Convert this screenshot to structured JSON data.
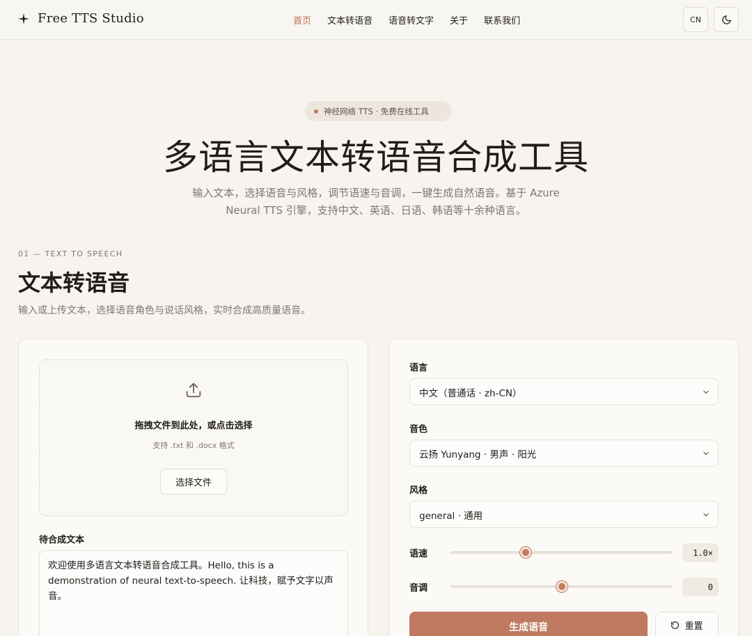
{
  "header": {
    "brand": "Free TTS Studio",
    "brand_icon": "sparkle-icon",
    "nav": [
      "首页",
      "文本转语音",
      "语音转文字",
      "关于",
      "联系我们"
    ],
    "active_nav": "首页",
    "lang_button": "CN",
    "theme_icon": "moon-icon"
  },
  "hero": {
    "badge": "神经网络 TTS · 免费在线工具",
    "title": "多语言文本转语音合成工具",
    "subtitle_line1": "输入文本，选择语音与风格，调节语速与音调，一键生成自然语音。基于 Azure",
    "subtitle_line2": "Neural TTS 引擎，支持中文、英语、日语、韩语等十余种语言。"
  },
  "section": {
    "eyebrow": "01 — TEXT TO SPEECH",
    "title": "文本转语音",
    "description": "输入或上传文本，选择语音角色与说话风格，实时合成高质量语音。"
  },
  "upload": {
    "icon": "upload-icon",
    "title": "拖拽文件到此处，或点击选择",
    "hint": "支持 .txt 和 .docx 格式",
    "button": "选择文件"
  },
  "text_input": {
    "label": "待合成文本",
    "value": "欢迎使用多语言文本转语音合成工具。Hello, this is a demonstration of neural text-to-speech. 让科技，赋予文字以声音。"
  },
  "settings": {
    "language_label": "语言",
    "language_value": "中文（普通话 · zh-CN）",
    "voice_label": "音色",
    "voice_value": "云扬 Yunyang · 男声 · 阳光",
    "style_label": "风格",
    "style_value": "general · 通用",
    "rate_label": "语速",
    "rate_value": "1.0×",
    "rate_level": 0.34,
    "pitch_label": "音调",
    "pitch_value": "0",
    "pitch_level": 0.5
  },
  "actions": {
    "generate": "生成语音",
    "reset": "重置",
    "reset_icon": "reset-icon"
  },
  "colors": {
    "accent": "#bf7a61",
    "background": "#f7f4ef",
    "active_nav": "#c0704f"
  }
}
